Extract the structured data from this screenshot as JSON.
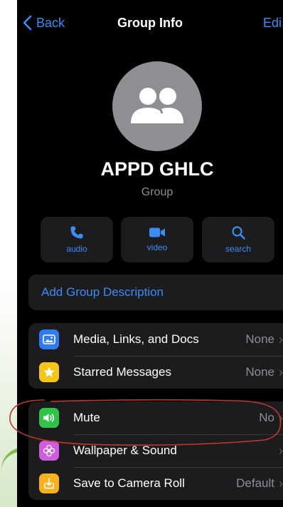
{
  "nav": {
    "back_label": "Back",
    "title": "Group Info",
    "edit_label": "Edi"
  },
  "group": {
    "name": "APPD GHLC",
    "subtitle": "Group"
  },
  "actions": [
    {
      "label": "audio",
      "icon": "phone-icon"
    },
    {
      "label": "video",
      "icon": "video-camera-icon"
    },
    {
      "label": "search",
      "icon": "search-icon"
    }
  ],
  "description": {
    "label": "Add Group Description"
  },
  "section1": [
    {
      "label": "Media, Links, and Docs",
      "value": "None",
      "icon": "photo-icon",
      "color": "#2f7bf6"
    },
    {
      "label": "Starred Messages",
      "value": "None",
      "icon": "star-icon",
      "color": "#f5c518"
    }
  ],
  "section2": [
    {
      "label": "Mute",
      "value": "No",
      "icon": "speaker-icon",
      "color": "#30c34a"
    },
    {
      "label": "Wallpaper & Sound",
      "value": "",
      "icon": "flower-icon",
      "color": "#d05ce0"
    },
    {
      "label": "Save to Camera Roll",
      "value": "Default",
      "icon": "download-icon",
      "color": "#f5b21a"
    }
  ],
  "colors": {
    "accent": "#3b8cf3",
    "background": "#000000",
    "card": "#1c1c1e",
    "secondary_text": "#8e8e93",
    "annotation": "#c0392b"
  }
}
